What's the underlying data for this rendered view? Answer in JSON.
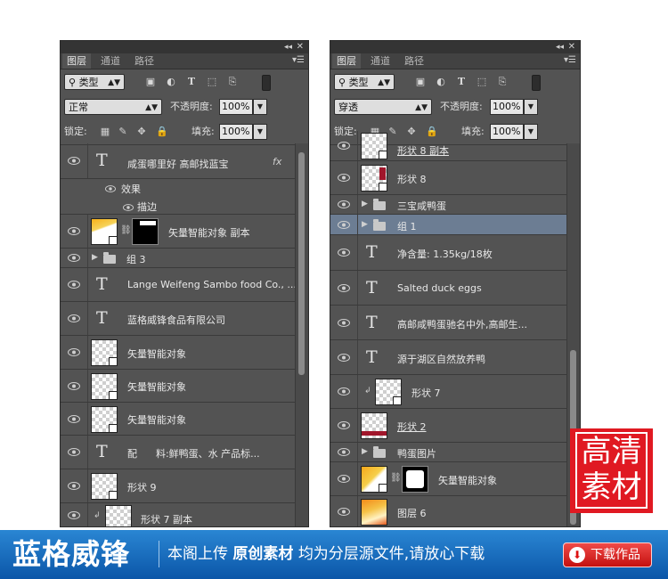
{
  "left_panel": {
    "tabs": [
      "图层",
      "通道",
      "路径"
    ],
    "filter_type": "类型",
    "blend_mode": "正常",
    "opacity_label": "不透明度:",
    "opacity_value": "100%",
    "lock_label": "锁定:",
    "fill_label": "填充:",
    "fill_value": "100%",
    "layers": [
      {
        "kind": "text",
        "name": "咸蛋哪里好 高邮找蓝宝",
        "fx": "fx"
      },
      {
        "kind": "effects",
        "name": "效果"
      },
      {
        "kind": "effect",
        "name": "描边"
      },
      {
        "kind": "smart_masked",
        "name": "矢量智能对象 副本"
      },
      {
        "kind": "group",
        "name": "组 3"
      },
      {
        "kind": "text",
        "name": "Lange Weifeng Sambo food Co., ..."
      },
      {
        "kind": "text",
        "name": "蓝格威锋食品有限公司"
      },
      {
        "kind": "smart",
        "name": "矢量智能对象"
      },
      {
        "kind": "smart",
        "name": "矢量智能对象"
      },
      {
        "kind": "smart",
        "name": "矢量智能对象"
      },
      {
        "kind": "text",
        "name": "配      料:鲜鸭蛋、水 产品标..."
      },
      {
        "kind": "shape",
        "name": "形状 9"
      },
      {
        "kind": "shape_clip",
        "name": "形状 7 副本"
      }
    ]
  },
  "right_panel": {
    "tabs": [
      "图层",
      "通道",
      "路径"
    ],
    "filter_type": "类型",
    "blend_mode": "穿透",
    "opacity_label": "不透明度:",
    "opacity_value": "100%",
    "lock_label": "锁定:",
    "fill_label": "填充:",
    "fill_value": "100%",
    "layers": [
      {
        "kind": "shape",
        "name": "形状 8 副本"
      },
      {
        "kind": "shape",
        "name": "形状 8"
      },
      {
        "kind": "group",
        "name": "三宝咸鸭蛋"
      },
      {
        "kind": "group_selected",
        "name": "组 1"
      },
      {
        "kind": "text",
        "name": "净含量: 1.35kg/18枚"
      },
      {
        "kind": "text",
        "name": "Salted duck eggs"
      },
      {
        "kind": "text",
        "name": "高邮咸鸭蛋驰名中外,高邮生..."
      },
      {
        "kind": "text",
        "name": "源于湖区自然放养鸭"
      },
      {
        "kind": "shape_clip",
        "name": "形状 7"
      },
      {
        "kind": "shape",
        "name": "形状 2"
      },
      {
        "kind": "group",
        "name": "鸭蛋图片"
      },
      {
        "kind": "smart_masked",
        "name": "矢量智能对象"
      },
      {
        "kind": "image",
        "name": "图层 6"
      }
    ]
  },
  "watermark": {
    "line1": "高清",
    "line2": "素材"
  },
  "banner": {
    "logo": "蓝格威锋",
    "msg_pre": "本阁上传",
    "msg_bold": "原创素材",
    "msg_post": "均为分层源文件,请放心下载",
    "download_label": "下载作品",
    "download_icon": "⬇"
  }
}
